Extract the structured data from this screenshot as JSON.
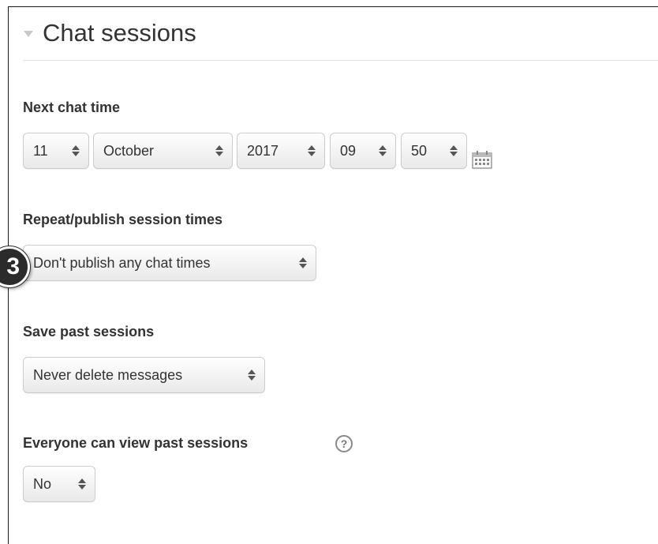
{
  "section": {
    "title": "Chat sessions"
  },
  "next_chat_time": {
    "label": "Next chat time",
    "day": "11",
    "month": "October",
    "year": "2017",
    "hour": "09",
    "minute": "50"
  },
  "repeat": {
    "label": "Repeat/publish session times",
    "value": "Don't publish any chat times"
  },
  "save_past": {
    "label": "Save past sessions",
    "value": "Never delete messages"
  },
  "everyone_view": {
    "label": "Everyone can view past sessions",
    "value": "No",
    "help_glyph": "?"
  },
  "annotation": {
    "step_number": "3"
  },
  "icons": {
    "collapse": "caret-down-icon",
    "calendar": "calendar-icon",
    "help": "help-icon"
  }
}
